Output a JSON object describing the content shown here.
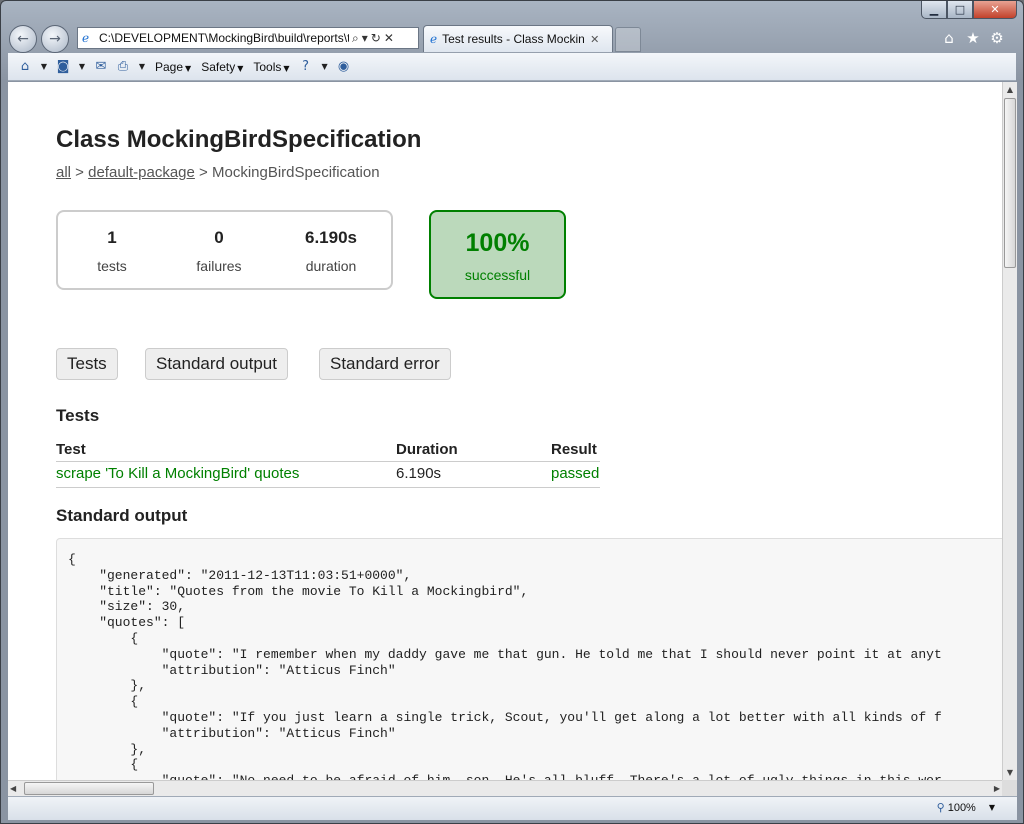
{
  "browser": {
    "caption": {
      "minimize": "▁",
      "maximize": "□",
      "close": "✕"
    },
    "nav": {
      "back_icon": "←",
      "forward_icon": "→"
    },
    "address": {
      "url": "C:\\DEVELOPMENT\\MockingBird\\build\\reports\\te",
      "search_glyph": "⌕",
      "dropdown_glyph": "▾",
      "refresh_glyph": "↻",
      "stop_glyph": "✕"
    },
    "tab": {
      "title": "Test results - Class Mockin...",
      "close_glyph": "✕"
    },
    "right_icons": {
      "home": "⌂",
      "favorites": "★",
      "tools": "⚙"
    },
    "command_bar": {
      "items": [
        {
          "label": "Page"
        },
        {
          "label": "Safety"
        },
        {
          "label": "Tools"
        }
      ]
    },
    "status": {
      "zoom": "100%"
    }
  },
  "page": {
    "title": "Class MockingBirdSpecification",
    "breadcrumb": {
      "all": "all",
      "sep1": " > ",
      "package": "default-package",
      "sep2": " > ",
      "current": "MockingBirdSpecification"
    },
    "summary": {
      "tests_count": "1",
      "tests_label": "tests",
      "failures_count": "0",
      "failures_label": "failures",
      "duration_value": "6.190s",
      "duration_label": "duration"
    },
    "success": {
      "percent": "100%",
      "label": "successful"
    },
    "tab_buttons": [
      "Tests",
      "Standard output",
      "Standard error"
    ],
    "tests_heading": "Tests",
    "tests_table": {
      "headers": [
        "Test",
        "Duration",
        "Result"
      ],
      "rows": [
        {
          "test": "scrape 'To Kill a MockingBird' quotes",
          "duration": "6.190s",
          "result": "passed"
        }
      ]
    },
    "stdout_heading": "Standard output",
    "stdout_text": "{\n    \"generated\": \"2011-12-13T11:03:51+0000\",\n    \"title\": \"Quotes from the movie To Kill a Mockingbird\",\n    \"size\": 30,\n    \"quotes\": [\n        {\n            \"quote\": \"I remember when my daddy gave me that gun. He told me that I should never point it at anyt\n            \"attribution\": \"Atticus Finch\"\n        },\n        {\n            \"quote\": \"If you just learn a single trick, Scout, you'll get along a lot better with all kinds of f\n            \"attribution\": \"Atticus Finch\"\n        },\n        {\n            \"quote\": \"No need to be afraid of him, son. He's all bluff. There's a lot of ugly things in this wor"
  },
  "colors": {
    "success_green": "#008000",
    "success_bg": "#bbd9bb",
    "link_gray": "#555555"
  }
}
